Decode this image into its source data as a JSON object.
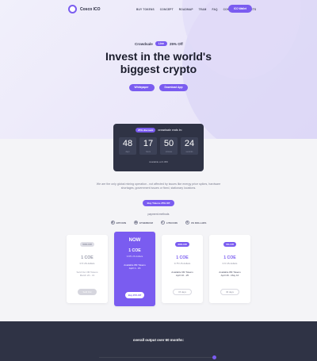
{
  "brand": {
    "logo_text": "Cosco ICO",
    "accent": "#7a5cf0"
  },
  "nav": {
    "items": [
      "BUY TOKENS",
      "CONCEPT",
      "ROADMAP",
      "TEAM",
      "FAQ",
      "CONTACT",
      "CABINETS"
    ],
    "wallet_button": "ICO Wallet"
  },
  "hero": {
    "crowdsale_label": "Crowdsale",
    "crowdsale_pill": "Live",
    "crowdsale_off": "25% Off",
    "headline_line1": "Invest in the world's",
    "headline_line2": "biggest crypto",
    "btn_whitepaper": "Whitepaper",
    "btn_download": "Download App"
  },
  "counter": {
    "pill": "25% discount",
    "text": "crowdsale ends in:",
    "days": "48",
    "hours": "17",
    "minutes": "50",
    "seconds": "24",
    "unit_days": "days",
    "unit_hours": "hours",
    "unit_minutes": "minutes",
    "unit_seconds": "seconds",
    "footer": "Available at 0.456"
  },
  "intro": {
    "description": "We are the only global mining operation - not affected by issues like energy price spikes, hardware shortages, government issues or fixed, stationary locations.",
    "buy_button": "Buy Tokens 25% Off",
    "payment_title": "payment methods",
    "payments": [
      "BITCOIN",
      "ETHEREUM",
      "LITECOIN",
      "US DOLLARS"
    ]
  },
  "cards": [
    {
      "badge": "50% Off",
      "coe": "1 COE",
      "price": "0.5 US dollars",
      "avail": "Sold Out 3M Tokens",
      "date": "March 20 - 31",
      "cta": "Sold Out",
      "state": "sold"
    },
    {
      "badge": "NOW",
      "coe": "1 COE",
      "price": "0.65 US dollars",
      "avail": "Available 8M Tokens",
      "date": "April 1 - 15",
      "cta": "Buy 25% Off",
      "state": "featured"
    },
    {
      "badge": "20% Off",
      "coe": "1 COE",
      "price": "0.75 US dollars",
      "avail": "Available 6M Tokens",
      "date": "April 16 - 25",
      "cta": "15 days",
      "state": "future"
    },
    {
      "badge": "5% Off",
      "coe": "1 COE",
      "price": "0.9 US dollars",
      "avail": "Available 8M Tokens",
      "date": "April 26 - May 10",
      "cta": "30 days",
      "state": "future"
    }
  ],
  "output": {
    "title": "overall output over 60 months:"
  }
}
